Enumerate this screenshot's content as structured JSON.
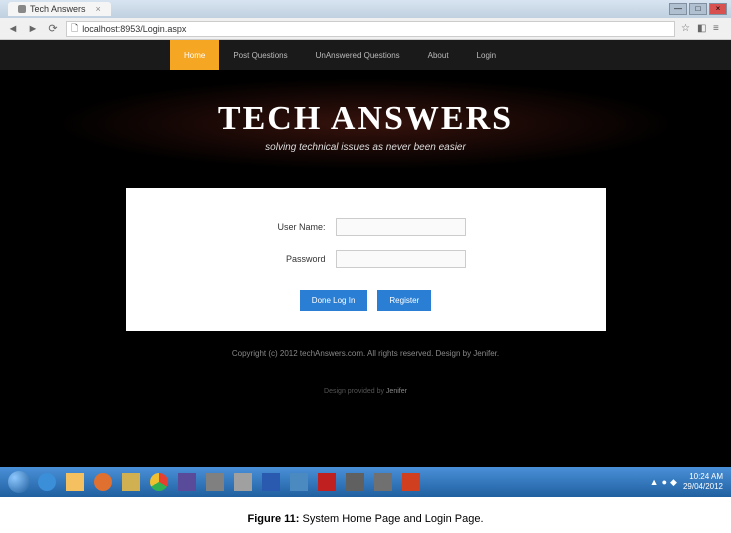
{
  "browser": {
    "tab_title": "Tech Answers",
    "url": "localhost:8953/Login.aspx",
    "window_min": "—",
    "window_max": "□",
    "window_close": "×"
  },
  "navbar": {
    "items": [
      {
        "label": "Home",
        "active": true
      },
      {
        "label": "Post Questions",
        "active": false
      },
      {
        "label": "UnAnswered Questions",
        "active": false
      },
      {
        "label": "About",
        "active": false
      },
      {
        "label": "Login",
        "active": false
      }
    ]
  },
  "hero": {
    "title": "TECH ANSWERS",
    "subtitle": "solving technical issues as never been easier"
  },
  "login": {
    "username_label": "User Name:",
    "username_value": "",
    "password_label": "Password",
    "password_value": "",
    "login_btn": "Done Log In",
    "register_btn": "Register"
  },
  "footer": {
    "copyright": "Copyright (c) 2012 techAnswers.com. All rights reserved. Design by Jenifer.",
    "design_prefix": "Design provided by ",
    "design_link": "Jenifer"
  },
  "taskbar": {
    "items": [
      "start",
      "ie",
      "explorer",
      "media",
      "folder",
      "chrome",
      "app1",
      "app2",
      "app3",
      "word",
      "app4",
      "adobe",
      "app5",
      "app6",
      "powerpoint"
    ],
    "tray_icons": [
      "▲",
      "●",
      "◆",
      "📶"
    ],
    "time": "10:24 AM",
    "date": "29/04/2012"
  },
  "caption": {
    "label": "Figure 11:",
    "text": " System Home Page and Login Page."
  }
}
